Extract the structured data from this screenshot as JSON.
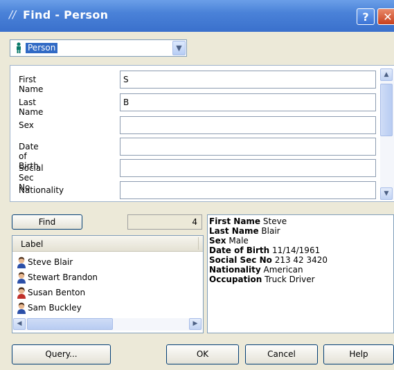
{
  "window": {
    "title": "Find - Person",
    "help_label": "?",
    "close_label": "✕"
  },
  "type_dropdown": {
    "selected": "Person"
  },
  "form": {
    "fields": [
      {
        "label": "First Name",
        "value": "S"
      },
      {
        "label": "Last Name",
        "value": "B"
      },
      {
        "label": "Sex",
        "value": ""
      },
      {
        "label": "Date of Birth",
        "value": ""
      },
      {
        "label": "Social Sec No",
        "value": ""
      },
      {
        "label": "Nationality",
        "value": ""
      }
    ]
  },
  "find_button": {
    "label": "Find"
  },
  "result_count": "4",
  "results": {
    "header": "Label",
    "items": [
      {
        "label": "Steve Blair",
        "icon": "male-person-icon"
      },
      {
        "label": "Stewart Brandon",
        "icon": "male-person-icon"
      },
      {
        "label": "Susan Benton",
        "icon": "female-person-icon"
      },
      {
        "label": "Sam Buckley",
        "icon": "male-person-icon"
      }
    ]
  },
  "details": [
    {
      "key": "First Name",
      "value": "Steve"
    },
    {
      "key": "Last Name",
      "value": "Blair"
    },
    {
      "key": "Sex",
      "value": "Male"
    },
    {
      "key": "Date of Birth",
      "value": "11/14/1961"
    },
    {
      "key": "Social Sec No",
      "value": "213 42 3420"
    },
    {
      "key": "Nationality",
      "value": "American"
    },
    {
      "key": "Occupation",
      "value": "Truck Driver"
    }
  ],
  "footer": {
    "query_label": "Query...",
    "ok_label": "OK",
    "cancel_label": "Cancel",
    "help_label": "Help"
  },
  "colors": {
    "title_bar": "#3a70cc",
    "selection": "#316ac5",
    "dialog_bg": "#ece9d8"
  }
}
